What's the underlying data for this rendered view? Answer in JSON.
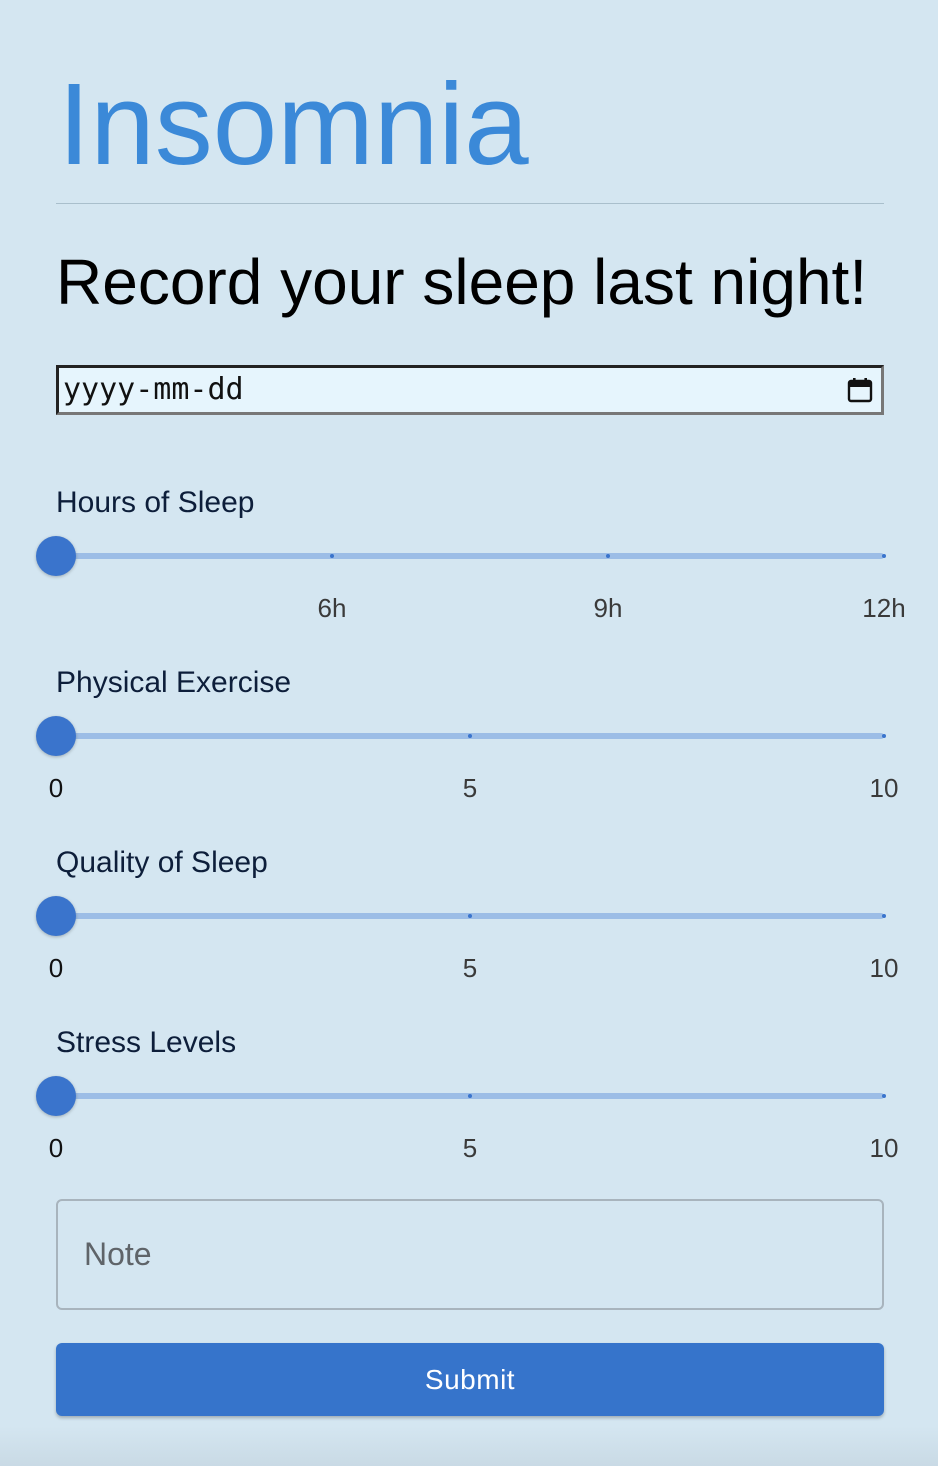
{
  "app": {
    "title": "Insomnia"
  },
  "form": {
    "heading": "Record your sleep last night!",
    "date_placeholder": "yyyy-mm-dd",
    "calendar_icon": "calendar-icon",
    "note_placeholder": "Note",
    "submit_label": "Submit"
  },
  "sliders": [
    {
      "label": "Hours of Sleep",
      "value": 3,
      "min": 3,
      "max": 12,
      "marks": [
        {
          "value": 6,
          "label": "6h"
        },
        {
          "value": 9,
          "label": "9h"
        },
        {
          "value": 12,
          "label": "12h"
        }
      ]
    },
    {
      "label": "Physical Exercise",
      "value": 0,
      "min": 0,
      "max": 10,
      "marks": [
        {
          "value": 0,
          "label": "0"
        },
        {
          "value": 5,
          "label": "5"
        },
        {
          "value": 10,
          "label": "10"
        }
      ]
    },
    {
      "label": "Quality of Sleep",
      "value": 0,
      "min": 0,
      "max": 10,
      "marks": [
        {
          "value": 0,
          "label": "0"
        },
        {
          "value": 5,
          "label": "5"
        },
        {
          "value": 10,
          "label": "10"
        }
      ]
    },
    {
      "label": "Stress Levels",
      "value": 0,
      "min": 0,
      "max": 10,
      "marks": [
        {
          "value": 0,
          "label": "0"
        },
        {
          "value": 5,
          "label": "5"
        },
        {
          "value": 10,
          "label": "10"
        }
      ]
    }
  ],
  "colors": {
    "background": "#d4e6f1",
    "title": "#3b89d8",
    "accent": "#3674cb",
    "track": "#9cbde6"
  }
}
